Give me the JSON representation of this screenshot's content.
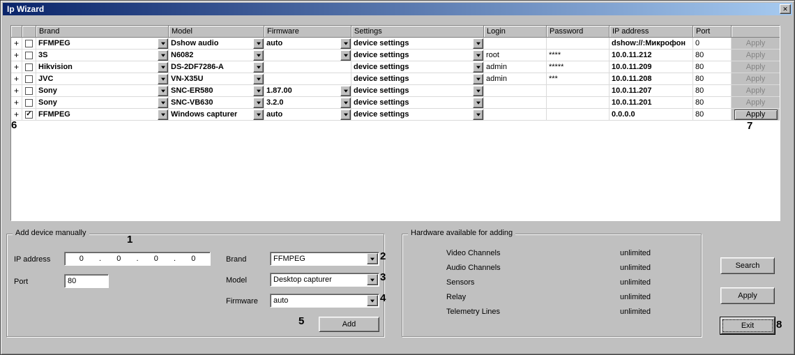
{
  "window": {
    "title": "Ip Wizard"
  },
  "icons": {
    "close": "✕",
    "expand": "+",
    "check": "✓",
    "dropdown": "▼"
  },
  "table": {
    "headers": {
      "brand": "Brand",
      "model": "Model",
      "firmware": "Firmware",
      "settings": "Settings",
      "login": "Login",
      "password": "Password",
      "ip": "IP address",
      "port": "Port"
    },
    "rows": [
      {
        "checked": false,
        "brand": "FFMPEG",
        "model": "Dshow audio",
        "firmware": "auto",
        "settings": "device settings",
        "login": "",
        "password": "",
        "ip": "dshow://:Микрофон",
        "port": "0",
        "apply": "Apply"
      },
      {
        "checked": false,
        "brand": "3S",
        "model": "N6082",
        "firmware": "",
        "settings": "device settings",
        "login": "root",
        "password": "****",
        "ip": "10.0.11.212",
        "port": "80",
        "apply": "Apply"
      },
      {
        "checked": false,
        "brand": "Hikvision",
        "model": "DS-2DF7286-A",
        "firmware": "",
        "settings": "device settings",
        "login": "admin",
        "password": "*****",
        "ip": "10.0.11.209",
        "port": "80",
        "apply": "Apply"
      },
      {
        "checked": false,
        "brand": "JVC",
        "model": "VN-X35U",
        "firmware": "",
        "settings": "device settings",
        "login": "admin",
        "password": "***",
        "ip": "10.0.11.208",
        "port": "80",
        "apply": "Apply"
      },
      {
        "checked": false,
        "brand": "Sony",
        "model": "SNC-ER580",
        "firmware": "1.87.00",
        "settings": "device settings",
        "login": "",
        "password": "",
        "ip": "10.0.11.207",
        "port": "80",
        "apply": "Apply"
      },
      {
        "checked": false,
        "brand": "Sony",
        "model": "SNC-VB630",
        "firmware": "3.2.0",
        "settings": "device settings",
        "login": "",
        "password": "",
        "ip": "10.0.11.201",
        "port": "80",
        "apply": "Apply"
      },
      {
        "checked": true,
        "brand": "FFMPEG",
        "model": "Windows capturer",
        "firmware": "auto",
        "settings": "device settings",
        "login": "",
        "password": "",
        "ip": "0.0.0.0",
        "port": "80",
        "apply": "Apply"
      }
    ]
  },
  "add_device": {
    "legend": "Add device manually",
    "ip_label": "IP address",
    "ip_octets": [
      "0",
      "0",
      "0",
      "0"
    ],
    "ip_separator": ".",
    "port_label": "Port",
    "port_value": "80",
    "brand_label": "Brand",
    "brand_value": "FFMPEG",
    "model_label": "Model",
    "model_value": "Desktop capturer",
    "firmware_label": "Firmware",
    "firmware_value": "auto",
    "add_button": "Add"
  },
  "hardware": {
    "legend": "Hardware available for adding",
    "items": [
      {
        "label": "Video Channels",
        "value": "unlimited"
      },
      {
        "label": "Audio Channels",
        "value": "unlimited"
      },
      {
        "label": "Sensors",
        "value": "unlimited"
      },
      {
        "label": "Relay",
        "value": "unlimited"
      },
      {
        "label": "Telemetry Lines",
        "value": "unlimited"
      }
    ]
  },
  "actions": {
    "search": "Search",
    "apply": "Apply",
    "exit": "Exit"
  },
  "callouts": [
    "1",
    "2",
    "3",
    "4",
    "5",
    "6",
    "7",
    "8"
  ]
}
